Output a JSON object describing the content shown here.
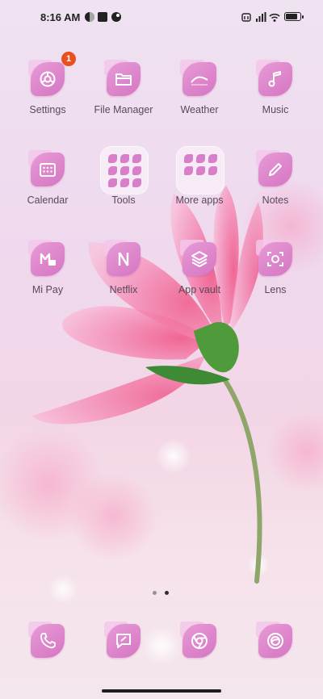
{
  "status_bar": {
    "time": "8:16 AM",
    "left_icons": [
      "notification-app-icon",
      "square-app-icon",
      "notification-app-icon-2"
    ],
    "right_icons": [
      "alarm-icon",
      "signal-icon",
      "wifi-icon",
      "battery-icon"
    ],
    "battery_level": 0.9
  },
  "apps": [
    {
      "label": "Settings",
      "icon": "gear-icon",
      "badge": "1"
    },
    {
      "label": "File Manager",
      "icon": "folder-icon"
    },
    {
      "label": "Weather",
      "icon": "weather-icon"
    },
    {
      "label": "Music",
      "icon": "music-note-icon"
    },
    {
      "label": "Calendar",
      "icon": "calendar-icon"
    },
    {
      "label": "Tools",
      "icon": "folder-tools-icon"
    },
    {
      "label": "More apps",
      "icon": "folder-more-apps-icon"
    },
    {
      "label": "Notes",
      "icon": "pen-icon"
    },
    {
      "label": "Mi Pay",
      "icon": "mi-pay-icon"
    },
    {
      "label": "Netflix",
      "icon": "netflix-icon"
    },
    {
      "label": "App vault",
      "icon": "layers-icon"
    },
    {
      "label": "Lens",
      "icon": "lens-scan-icon"
    }
  ],
  "page_indicator": {
    "pages": 2,
    "current": 2
  },
  "dock": [
    {
      "icon": "phone-icon"
    },
    {
      "icon": "messages-icon"
    },
    {
      "icon": "chrome-icon"
    },
    {
      "icon": "browser-icon"
    }
  ],
  "colors": {
    "accent": "#d575c3",
    "badge": "#e8501f"
  }
}
